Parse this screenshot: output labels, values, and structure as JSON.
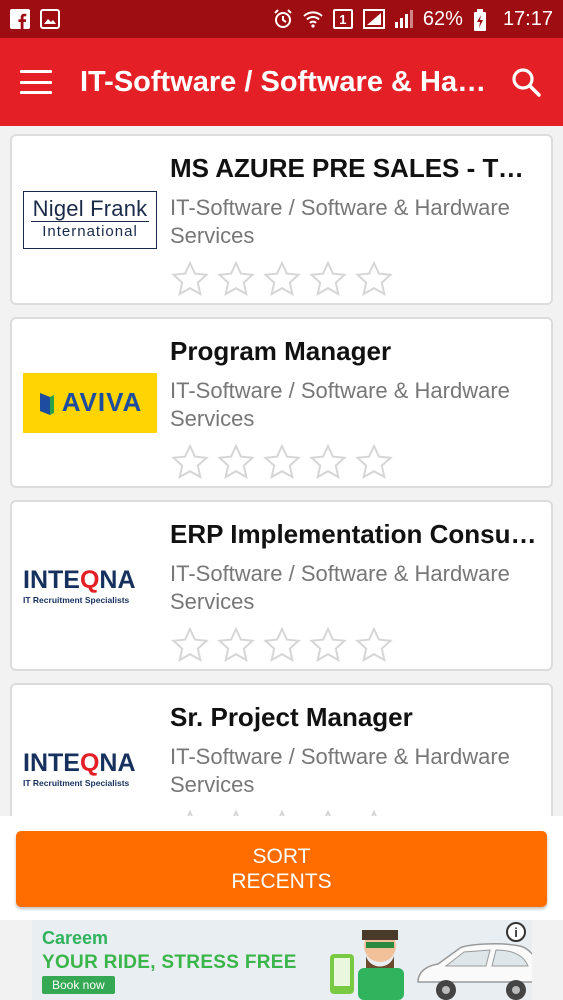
{
  "status_bar": {
    "battery": "62%",
    "time": "17:17",
    "sim_label": "1"
  },
  "app_bar": {
    "title": "IT-Software / Software & Hardware Services"
  },
  "jobs": [
    {
      "title": "MS AZURE PRE SALES - TOP MNC",
      "category": "IT-Software / Software & Hardware Services",
      "logo": "nigel-frank",
      "rating": 0
    },
    {
      "title": "Program Manager",
      "category": "IT-Software / Software & Hardware Services",
      "logo": "aviva",
      "rating": 0
    },
    {
      "title": "ERP Implementation Consultant",
      "category": "IT-Software / Software & Hardware Services",
      "logo": "inteqna",
      "rating": 0
    },
    {
      "title": "Sr. Project Manager",
      "category": "IT-Software / Software & Hardware Services",
      "logo": "inteqna",
      "rating": 0
    }
  ],
  "logos": {
    "nigel_frank_line1": "Nigel Frank",
    "nigel_frank_line2": "International",
    "aviva": "AVIVA",
    "inteqna_a": "INTE",
    "inteqna_q": "Q",
    "inteqna_b": "NA",
    "inteqna_sub": "IT Recruitment Specialists"
  },
  "sort_button": {
    "line1": "SORT",
    "line2": "RECENTS"
  },
  "ad": {
    "brand": "Careem",
    "tagline": "YOUR RIDE, STRESS FREE",
    "cta": "Book now",
    "info": "i"
  },
  "colors": {
    "status_bar": "#9e0d12",
    "app_bar": "#e41f26",
    "sort_button": "#ff6d00"
  }
}
